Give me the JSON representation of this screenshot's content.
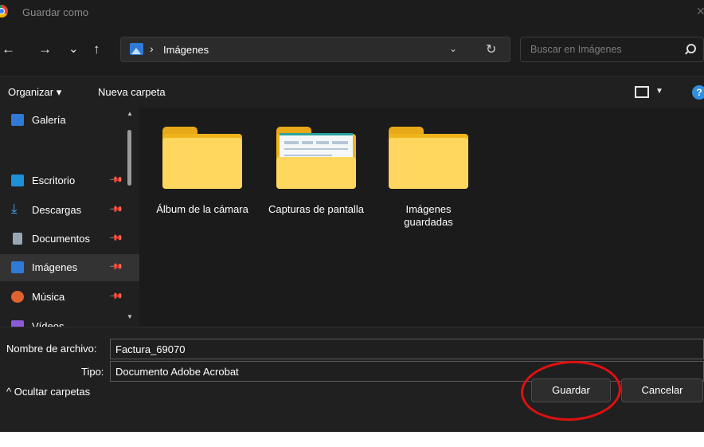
{
  "window": {
    "title": "Guardar como",
    "close_glyph": "✕"
  },
  "nav": {
    "back_glyph": "←",
    "forward_glyph": "→",
    "recent_glyph": "⌄",
    "up_glyph": "↑",
    "address": {
      "icon": "pictures-folder-icon",
      "separator": "›",
      "path": "Imágenes",
      "dropdown_glyph": "⌄",
      "refresh_glyph": "↻"
    },
    "search": {
      "placeholder": "Buscar en Imágenes"
    }
  },
  "toolbar": {
    "organize_label": "Organizar ▾",
    "new_folder_label": "Nueva carpeta",
    "view_dropdown_glyph": "▼",
    "help_glyph": "?"
  },
  "sidebar": {
    "items": [
      {
        "label": "Galería",
        "icon": "gallery-icon",
        "icon_color": "#2f7ad6",
        "pinned": false
      },
      {
        "label": "Escritorio",
        "icon": "desktop-icon",
        "icon_color": "#1e90d8",
        "pinned": true
      },
      {
        "label": "Descargas",
        "icon": "download-icon",
        "icon_color": "#3aa3e8",
        "pinned": true
      },
      {
        "label": "Documentos",
        "icon": "document-icon",
        "icon_color": "#9aa7b5",
        "pinned": true
      },
      {
        "label": "Imágenes",
        "icon": "pictures-icon",
        "icon_color": "#2f7ad6",
        "pinned": true,
        "selected": true
      },
      {
        "label": "Música",
        "icon": "music-icon",
        "icon_color": "#e0622f",
        "pinned": true
      },
      {
        "label": "Vídeos",
        "icon": "video-icon",
        "icon_color": "#8a5ad8",
        "pinned": true
      }
    ],
    "pin_glyph": "📌",
    "scroll_up_glyph": "▲",
    "scroll_down_glyph": "▼"
  },
  "folders": [
    {
      "label": "Álbum de la cámara",
      "thumbnail": false
    },
    {
      "label": "Capturas de pantalla",
      "thumbnail": true
    },
    {
      "label": "Imágenes guardadas",
      "thumbnail": false
    }
  ],
  "form": {
    "filename_label": "Nombre de archivo:",
    "filename_value": "Factura_69070",
    "type_label": "Tipo:",
    "type_value": "Documento Adobe Acrobat",
    "hide_folders_label": "^  Ocultar carpetas",
    "save_label": "Guardar",
    "cancel_label": "Cancelar"
  },
  "annotation": {
    "color": "#e01010",
    "target": "save-button"
  },
  "colors": {
    "dialog_bg": "#202020",
    "folder_yellow": "#f0b41a",
    "accent": "#2f8fe0"
  }
}
